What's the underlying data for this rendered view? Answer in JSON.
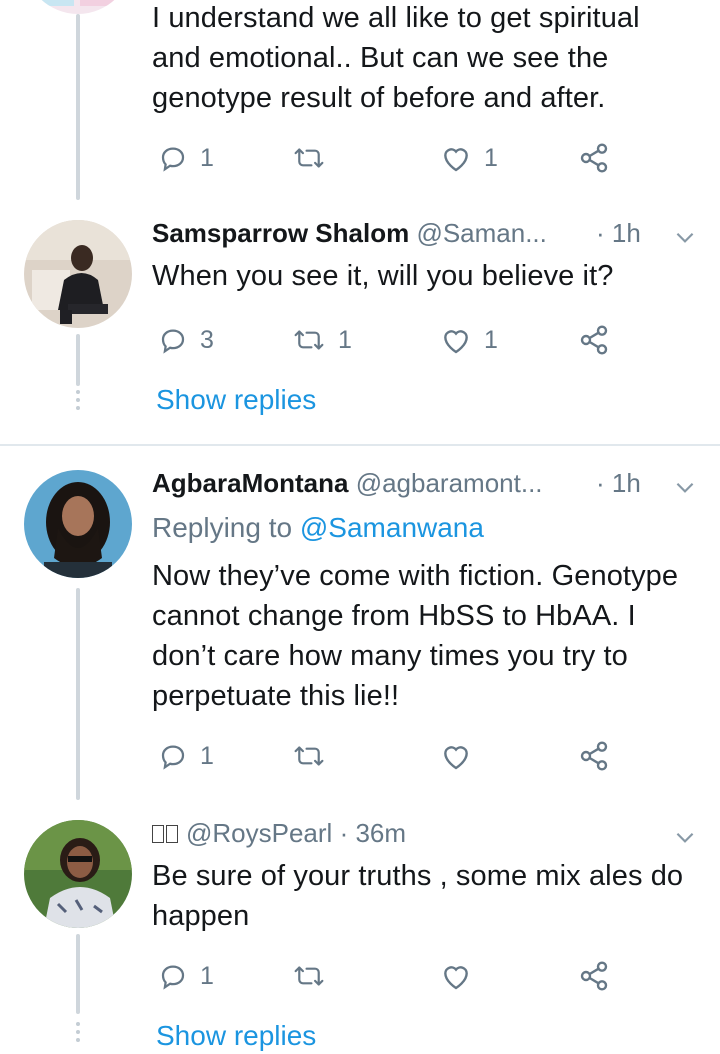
{
  "tweets": [
    {
      "text": "I understand we all like to get spiritual and emotional.. But can we see the genotype result of before and after.",
      "reply_count": "1",
      "retweet_count": "",
      "like_count": "1"
    },
    {
      "name": "Samsparrow Shalom",
      "handle": "@Saman...",
      "time": "· 1h",
      "text": "When you see it, will you believe it?",
      "reply_count": "3",
      "retweet_count": "1",
      "like_count": "1",
      "show_replies": "Show replies"
    },
    {
      "name": "AgbaraMontana",
      "handle": "@agbaramont...",
      "time": "· 1h",
      "replying_prefix": "Replying to",
      "replying_to": "@Samanwana",
      "text": "Now they’ve come with fiction. Genotype cannot change from HbSS to HbAA. I don’t care how many times you try to perpetuate this lie!!",
      "reply_count": "1",
      "retweet_count": "",
      "like_count": ""
    },
    {
      "name": "",
      "handle": "@RoysPearl",
      "time": "· 36m",
      "text": "Be sure of your truths , some mix ales do happen",
      "reply_count": "1",
      "retweet_count": "",
      "like_count": "",
      "show_replies": "Show replies"
    }
  ],
  "icons": [
    "reply-icon",
    "retweet-icon",
    "like-icon",
    "share-icon",
    "chevron-down-icon"
  ],
  "colors": {
    "link": "#1b95e0",
    "muted": "#657786",
    "text": "#14171a",
    "thread": "#cfd6dc"
  }
}
